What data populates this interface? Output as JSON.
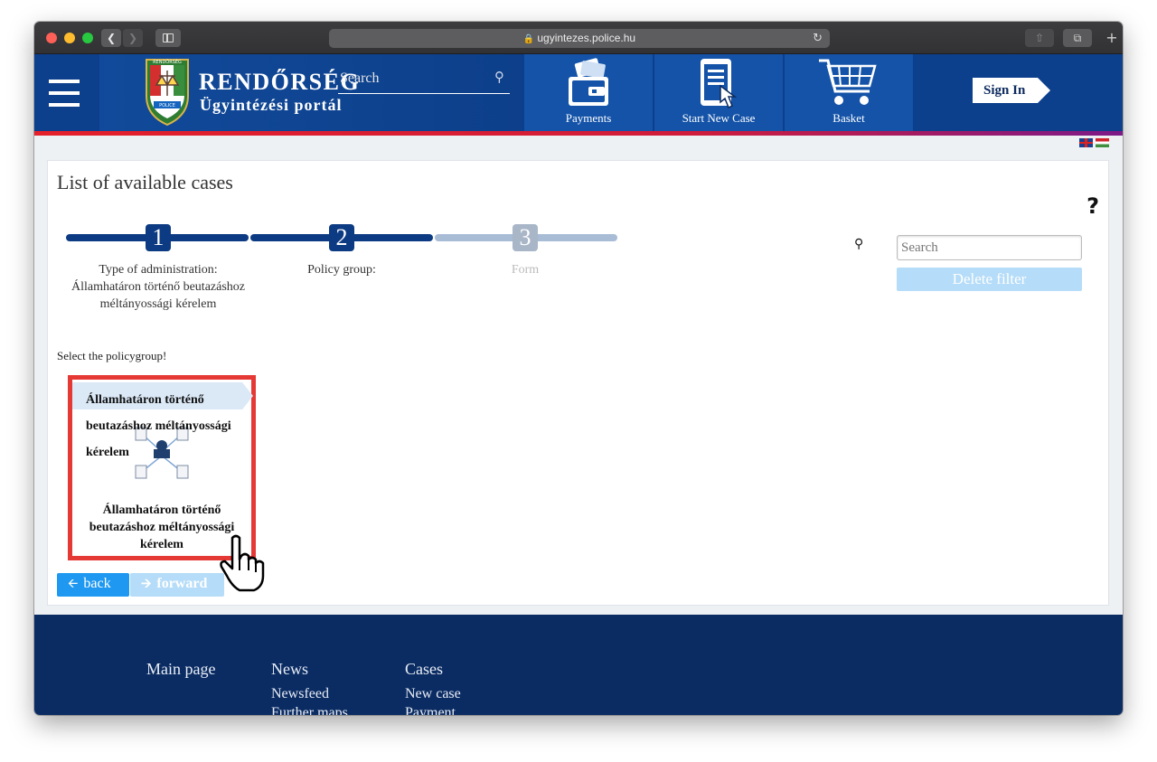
{
  "browser": {
    "url": "ugyintezes.police.hu"
  },
  "header": {
    "brand_title": "RENDŐRSÉG",
    "brand_subtitle": "Ügyintézési portál",
    "logo_top_text": "RENDŐRSÉG",
    "logo_bottom_text": "POLICE",
    "search_placeholder": "Search",
    "tiles": {
      "payments": "Payments",
      "start_new_case": "Start New Case",
      "basket": "Basket"
    },
    "sign_in": "Sign In"
  },
  "page": {
    "title": "List of available cases",
    "help": "?",
    "steps": [
      {
        "number": "1",
        "label": "Type of administration: Államhatáron történő beutazáshoz méltányossági kérelem"
      },
      {
        "number": "2",
        "label": "Policy group:"
      },
      {
        "number": "3",
        "label": "Form"
      }
    ],
    "search_placeholder": "Search",
    "delete_filter": "Delete filter",
    "select_hint": "Select the policygroup!",
    "card": {
      "title": "Államhatáron történő beutazáshoz méltányossági kérelem",
      "caption": "Államhatáron történő beutazáshoz méltányossági kérelem"
    },
    "back": "back",
    "forward": "forward"
  },
  "footer": {
    "main_page": "Main page",
    "news": {
      "heading": "News",
      "links": [
        "Newsfeed",
        "Further maps"
      ]
    },
    "cases": {
      "heading": "Cases",
      "links": [
        "New case",
        "Payment"
      ]
    }
  }
}
